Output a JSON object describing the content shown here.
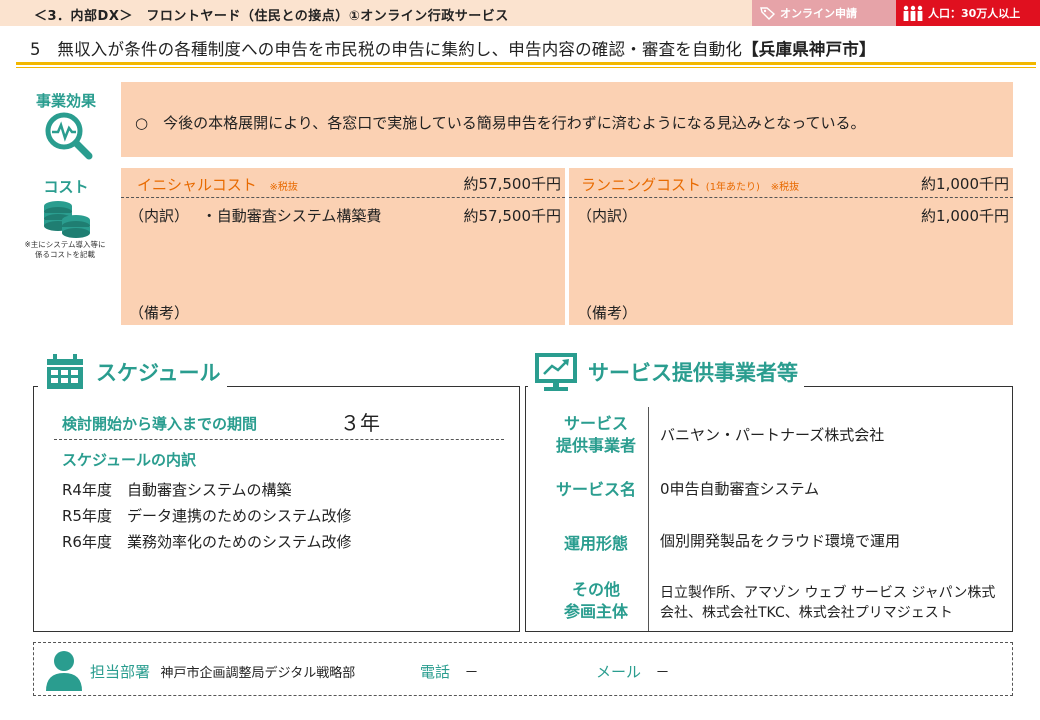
{
  "header": {
    "section": "＜3．内部DX＞　フロントヤード（住民との接点）①オンライン行政サービス",
    "tag_online": "オンライン申請",
    "tag_population": "人口：30万人以上",
    "title": "5　無収入が条件の各種制度への申告を市民税の申告に集約し、申告内容の確認・審査を自動化",
    "city": "【兵庫県神戸市】"
  },
  "effect": {
    "label": "事業効果",
    "text": "○　今後の本格展開により、各窓口で実施している簡易申告を行わずに済むようになる見込みとなっている。"
  },
  "cost": {
    "label": "コスト",
    "note": "※主にシステム導入等に係るコストを記載",
    "initial": {
      "title": "イニシャルコスト",
      "tax": "※税抜",
      "amount": "約57,500千円",
      "breakdown_label": "（内訳）",
      "item": "・自動審査システム構築費",
      "item_amount": "約57,500千円",
      "remarks": "（備考）"
    },
    "running": {
      "title": "ランニングコスト",
      "per_year": "(1年あたり)",
      "tax": "※税抜",
      "amount": "約1,000千円",
      "breakdown_label": "（内訳）",
      "item_amount": "約1,000千円",
      "remarks": "（備考）"
    }
  },
  "schedule": {
    "title": "スケジュール",
    "period_label": "検討開始から導入までの期間",
    "period_value": "３年",
    "breakdown_title": "スケジュールの内訳",
    "items": [
      "R4年度　自動審査システムの構築",
      "R5年度　データ連携のためのシステム改修",
      "R6年度　業務効率化のためのシステム改修"
    ]
  },
  "service": {
    "title": "サービス提供事業者等",
    "rows": [
      {
        "label_1": "サービス",
        "label_2": "提供事業者",
        "value": "バニヤン・パートナーズ株式会社"
      },
      {
        "label_1": "サービス名",
        "label_2": "",
        "value": "0申告自動審査システム"
      },
      {
        "label_1": "運用形態",
        "label_2": "",
        "value": "個別開発製品をクラウド環境で運用"
      },
      {
        "label_1": "その他",
        "label_2": "参画主体",
        "value": "日立製作所、アマゾン ウェブ サービス ジャパン株式会社、株式会社TKC、株式会社プリマジェスト"
      }
    ]
  },
  "footer": {
    "dept_label": "担当部署",
    "dept_value": "神戸市企画調整局デジタル戦略部",
    "phone_label": "電話",
    "phone_value": "－",
    "mail_label": "メール",
    "mail_value": "－"
  },
  "colors": {
    "accent_teal": "#2a9d8f",
    "accent_orange": "#e86a00",
    "panel_fill": "#fbd1b3",
    "rule": "#f2b700",
    "tag_red": "#e0101f"
  }
}
